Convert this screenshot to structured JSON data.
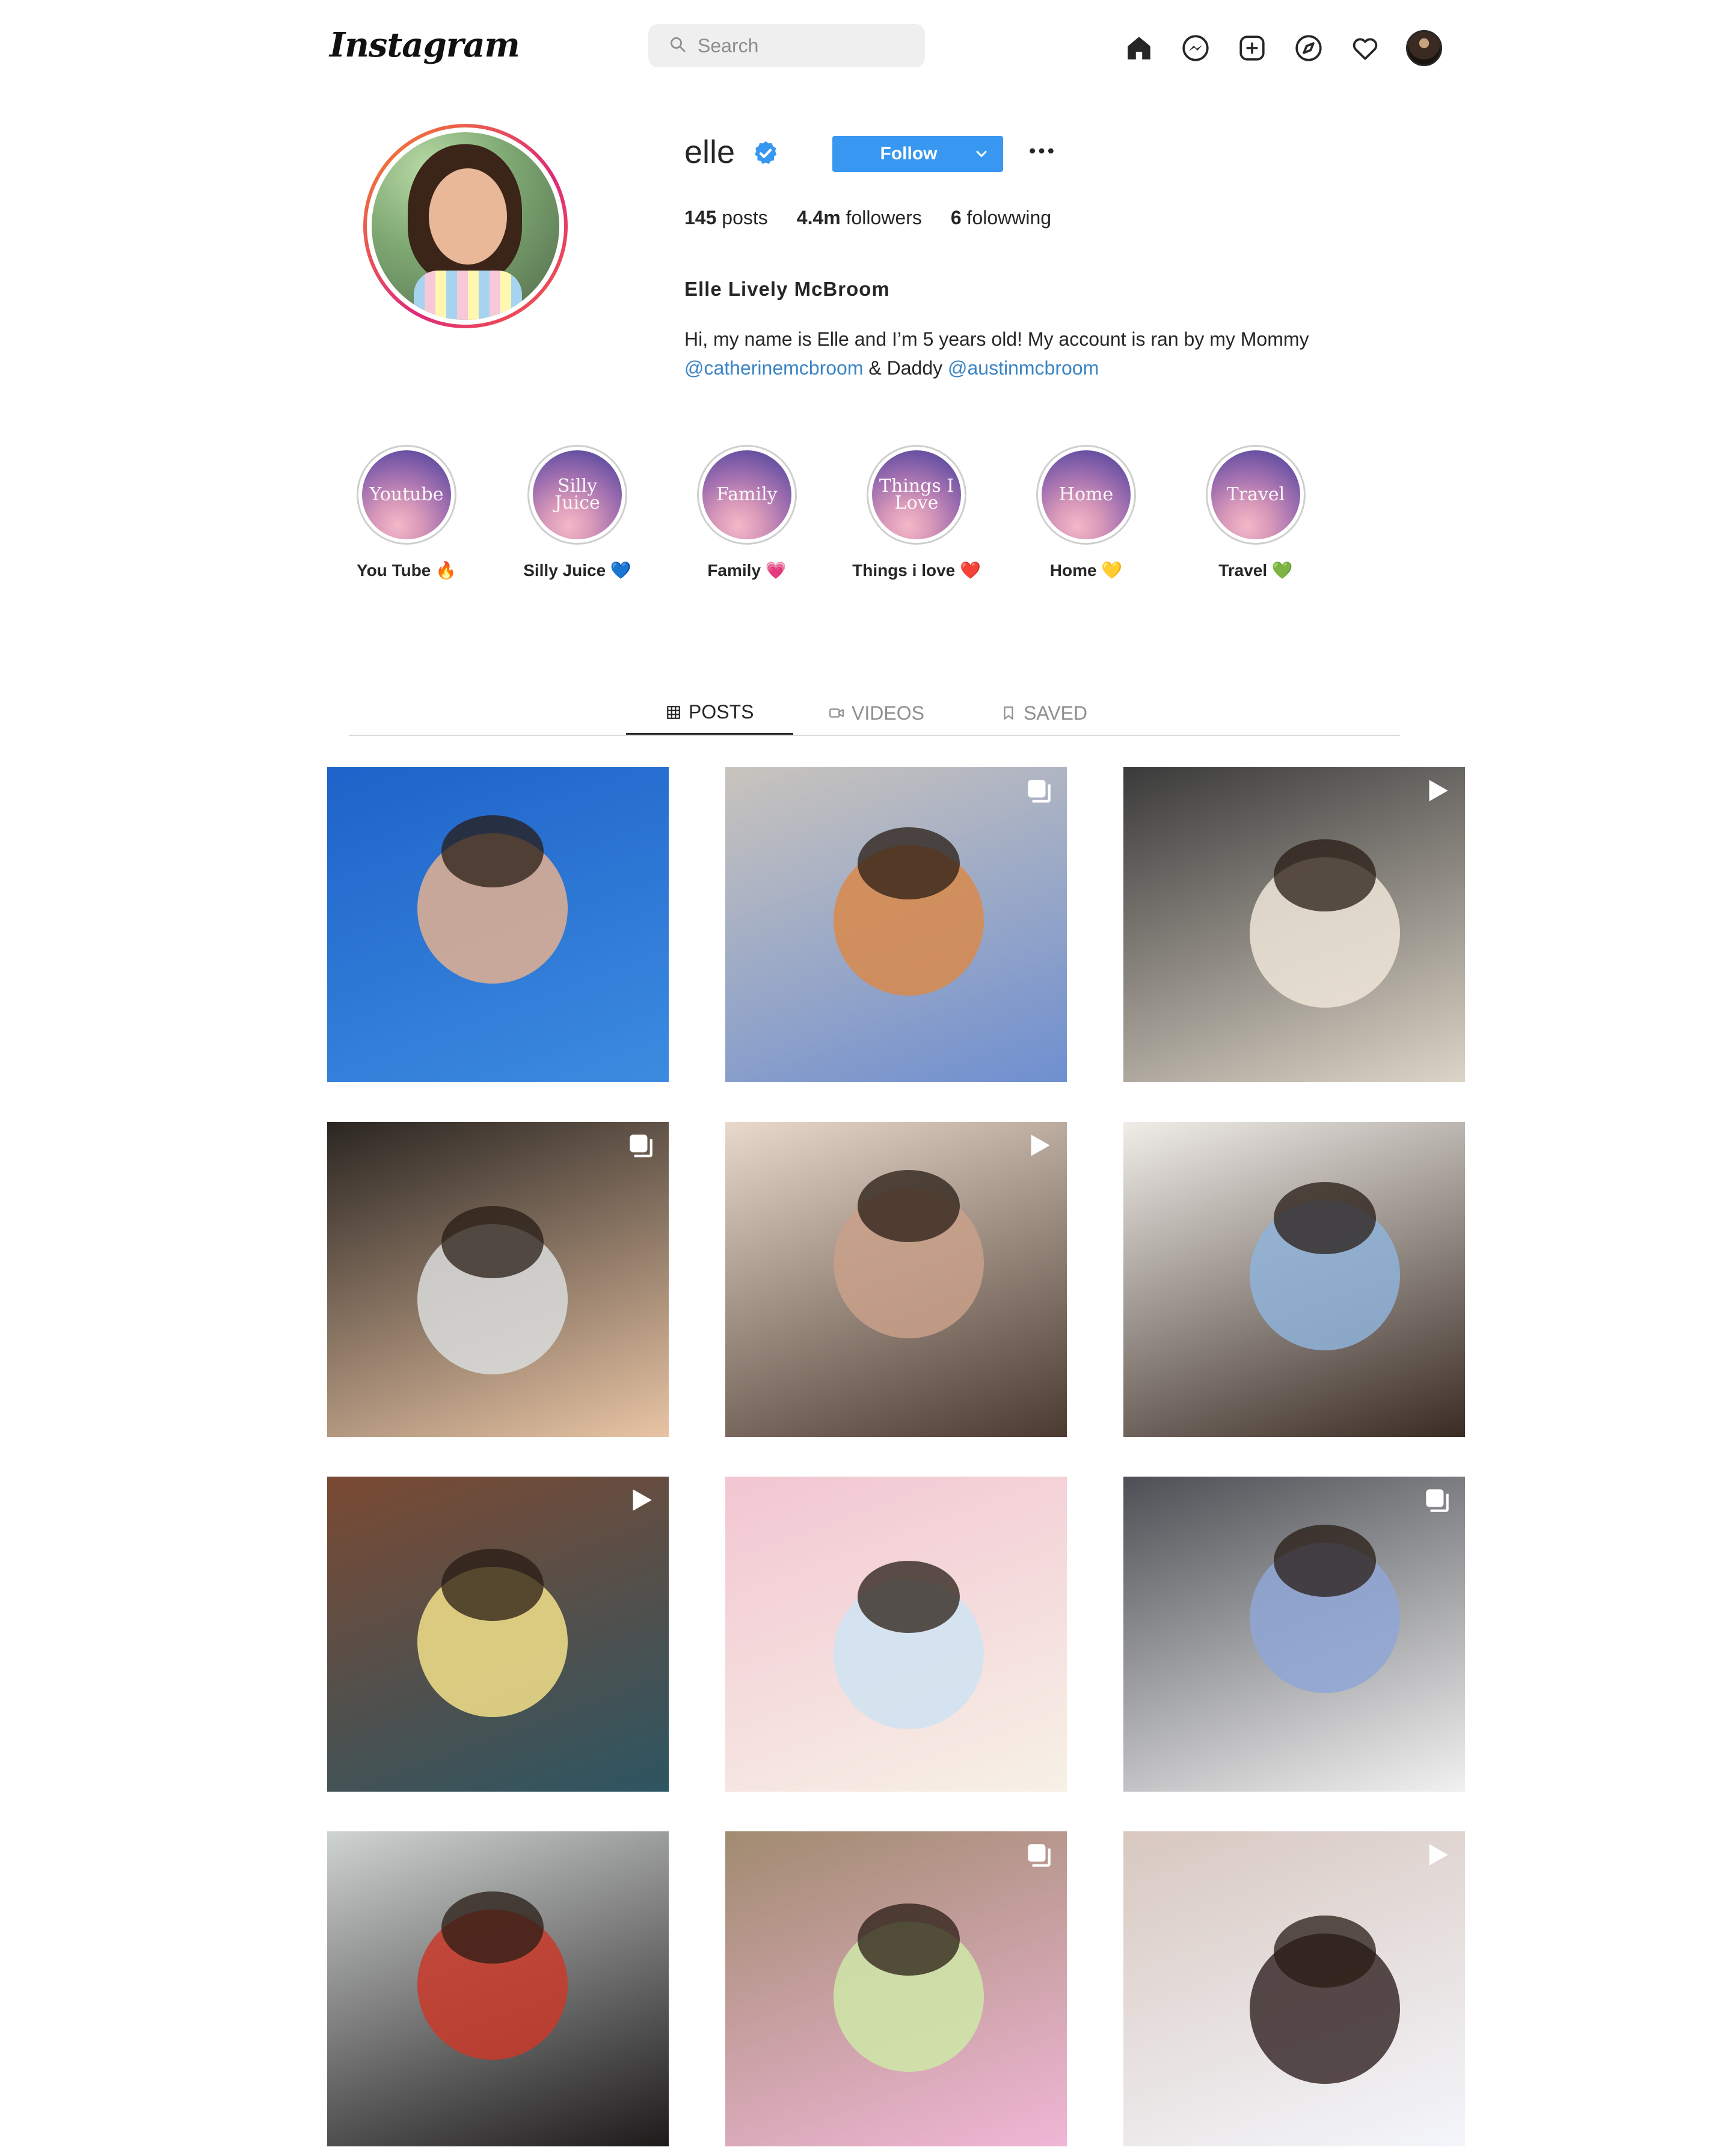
{
  "nav": {
    "logo": "Instagram",
    "search_placeholder": "Search",
    "icons": [
      "home-icon",
      "messenger-icon",
      "new-post-icon",
      "explore-icon",
      "activity-heart-icon",
      "profile-avatar"
    ]
  },
  "profile": {
    "username": "elle",
    "verified": true,
    "follow_label": "Follow",
    "stats": {
      "posts_count": "145",
      "posts_label": "posts",
      "followers_count": "4.4m",
      "followers_label": "followers",
      "following_count": "6",
      "following_label": "folowwing"
    },
    "full_name": "Elle Lively McBroom",
    "bio_text": "Hi, my name is Elle and I’m 5 years old! My account is ran by my Mommy",
    "bio_mention_1": "@catherinemcbroom",
    "bio_connector": "& Daddy",
    "bio_mention_2": "@austinmcbroom"
  },
  "highlights": [
    {
      "cover": "Youtube",
      "label": "You Tube 🔥"
    },
    {
      "cover": "Silly Juice",
      "label": "Silly Juice 💙"
    },
    {
      "cover": "Family",
      "label": "Family 💗"
    },
    {
      "cover": "Things I Love",
      "label": "Things i love ❤️"
    },
    {
      "cover": "Home",
      "label": "Home 💛"
    },
    {
      "cover": "Travel",
      "label": "Travel 💚"
    }
  ],
  "tabs": [
    {
      "label": "POSTS",
      "icon": "grid-icon",
      "active": true
    },
    {
      "label": "VIDEOS",
      "icon": "video-icon",
      "active": false
    },
    {
      "label": "SAVED",
      "icon": "bookmark-icon",
      "active": false
    }
  ],
  "posts": [
    {
      "type": "photo"
    },
    {
      "type": "carousel"
    },
    {
      "type": "video"
    },
    {
      "type": "carousel"
    },
    {
      "type": "video"
    },
    {
      "type": "photo"
    },
    {
      "type": "video"
    },
    {
      "type": "photo"
    },
    {
      "type": "carousel"
    },
    {
      "type": "photo"
    },
    {
      "type": "carousel"
    },
    {
      "type": "video"
    }
  ],
  "colors": {
    "accent": "#3897f0",
    "link": "#3a84c4",
    "text": "#262626",
    "muted": "#8e8e8e",
    "story_ring_start": "#f58529",
    "story_ring_end": "#dd2a7b"
  }
}
